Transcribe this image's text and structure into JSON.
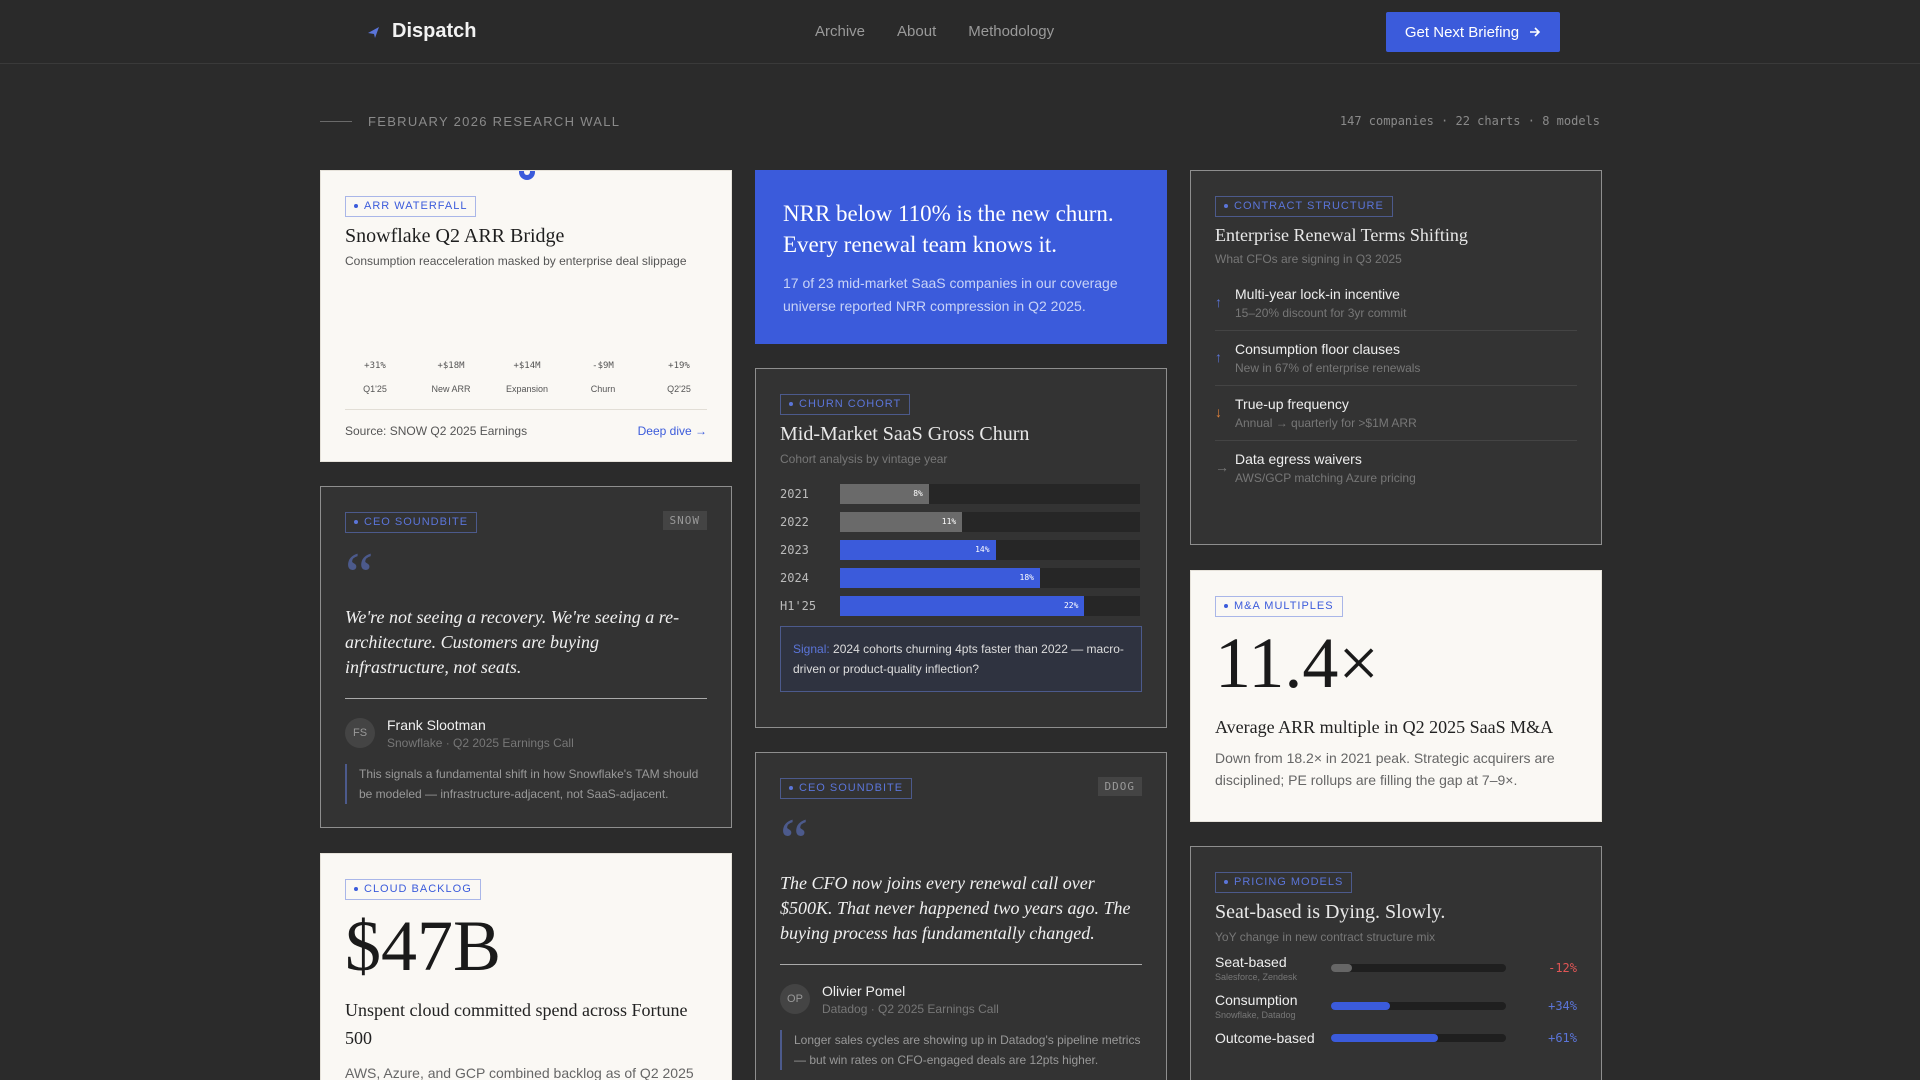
{
  "header": {
    "brand": "Dispatch",
    "nav": [
      "Archive",
      "About",
      "Methodology"
    ],
    "cta": "Get Next Briefing"
  },
  "wall": {
    "title": "FEBRUARY 2026 RESEARCH WALL",
    "stats": "147 companies · 22 charts · 8 models"
  },
  "card_waterfall": {
    "tag": "ARR WATERFALL",
    "title": "Snowflake Q2 ARR Bridge",
    "subtitle": "Consumption reacceleration masked by enterprise deal slippage",
    "source": "Source: SNOW Q2 2025 Earnings",
    "link": "Deep dive →"
  },
  "chart_data": {
    "type": "bar",
    "categories": [
      "Q1'25",
      "New ARR",
      "Expansion",
      "Churn",
      "Q2'25"
    ],
    "value_labels": [
      "+31%",
      "+$18M",
      "+$14M",
      "-$9M",
      "+19%"
    ]
  },
  "card_ceo1": {
    "tag": "CEO SOUNDBITE",
    "ticker": "SNOW",
    "quote_mark": "“",
    "quote": "We're not seeing a recovery. We're seeing a re-architecture. Customers are buying infrastructure, not seats.",
    "initials": "FS",
    "name": "Frank Slootman",
    "role": "Snowflake · Q2 2025 Earnings Call",
    "note": "This signals a fundamental shift in how Snowflake's TAM should be modeled — infrastructure-adjacent, not SaaS-adjacent."
  },
  "card_backlog": {
    "tag": "CLOUD BACKLOG",
    "big": "$47B",
    "caption": "Unspent cloud committed spend across Fortune 500",
    "sub": "AWS, Azure, and GCP combined backlog as of Q2 2025"
  },
  "card_hero": {
    "title": "NRR below 110% is the new churn. Every renewal team knows it.",
    "body": "17 of 23 mid-market SaaS companies in our coverage universe reported NRR compression in Q2 2025."
  },
  "card_churn": {
    "tag": "CHURN COHORT",
    "title": "Mid-Market SaaS Gross Churn",
    "subtitle": "Cohort analysis by vintage year",
    "rows": [
      {
        "year": "2021",
        "value": 8,
        "label": "8%"
      },
      {
        "year": "2022",
        "value": 11,
        "label": "11%"
      },
      {
        "year": "2023",
        "value": 14,
        "label": "14%"
      },
      {
        "year": "2024",
        "value": 18,
        "label": "18%"
      },
      {
        "year": "H1'25",
        "value": 22,
        "label": "22%"
      }
    ],
    "signal_label": "Signal:",
    "signal_text": "2024 cohorts churning 4pts faster than 2022 — macro-driven or product-quality inflection?"
  },
  "card_ceo2": {
    "tag": "CEO SOUNDBITE",
    "ticker": "DDOG",
    "quote_mark": "“",
    "quote": "The CFO now joins every renewal call over $500K. That never happened two years ago. The buying process has fundamentally changed.",
    "initials": "OP",
    "name": "Olivier Pomel",
    "role": "Datadog · Q2 2025 Earnings Call",
    "note": "Longer sales cycles are showing up in Datadog's pipeline metrics — but win rates on CFO-engaged deals are 12pts higher."
  },
  "card_contract": {
    "tag": "CONTRACT STRUCTURE",
    "title": "Enterprise Renewal Terms Shifting",
    "subtitle": "What CFOs are signing in Q3 2025",
    "terms": [
      {
        "arrow": "↑",
        "title": "Multi-year lock-in incentive",
        "sub": "15–20% discount for 3yr commit"
      },
      {
        "arrow": "↑",
        "title": "Consumption floor clauses",
        "sub": "New in 67% of enterprise renewals"
      },
      {
        "arrow": "↓",
        "title": "True-up frequency",
        "sub": "Annual → quarterly for >$1M ARR"
      },
      {
        "arrow": "→",
        "title": "Data egress waivers",
        "sub": "AWS/GCP matching Azure pricing"
      }
    ]
  },
  "card_ma": {
    "tag": "M&A MULTIPLES",
    "big": "11.4×",
    "caption": "Average ARR multiple in Q2 2025 SaaS M&A",
    "sub": "Down from 18.2× in 2021 peak. Strategic acquirers are disciplined; PE rollups are filling the gap at 7–9×."
  },
  "card_pricing": {
    "tag": "PRICING MODELS",
    "title": "Seat-based is Dying. Slowly.",
    "subtitle": "YoY change in new contract structure mix",
    "rows": [
      {
        "name": "Seat-based",
        "examples": "Salesforce, Zendesk",
        "value": -12,
        "label": "-12%"
      },
      {
        "name": "Consumption",
        "examples": "Snowflake, Datadog",
        "value": 34,
        "label": "+34%"
      },
      {
        "name": "Outcome-based",
        "examples": "",
        "value": 61,
        "label": "+61%"
      }
    ]
  },
  "colors": {
    "accent": "#3b5bdb",
    "negative": "#e05555",
    "positive": "#5b75d9",
    "neutral_bar": "#6a6a6a"
  }
}
